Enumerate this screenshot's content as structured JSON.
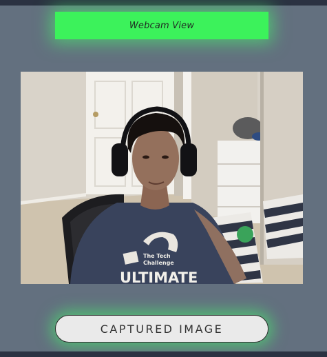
{
  "header": {
    "title": "Webcam View"
  },
  "webcam": {
    "feed": "webcam-feed",
    "shirt_text": {
      "line1": "The Tech",
      "line2": "Challenge",
      "line3": "ULTIMATE"
    }
  },
  "capture_button": {
    "label": "CAPTURED IMAGE"
  },
  "colors": {
    "header_bg": "#3cf25b",
    "page_bg": "#63707f",
    "frame_bar": "#2b3242",
    "glow": "#46ff6e"
  }
}
